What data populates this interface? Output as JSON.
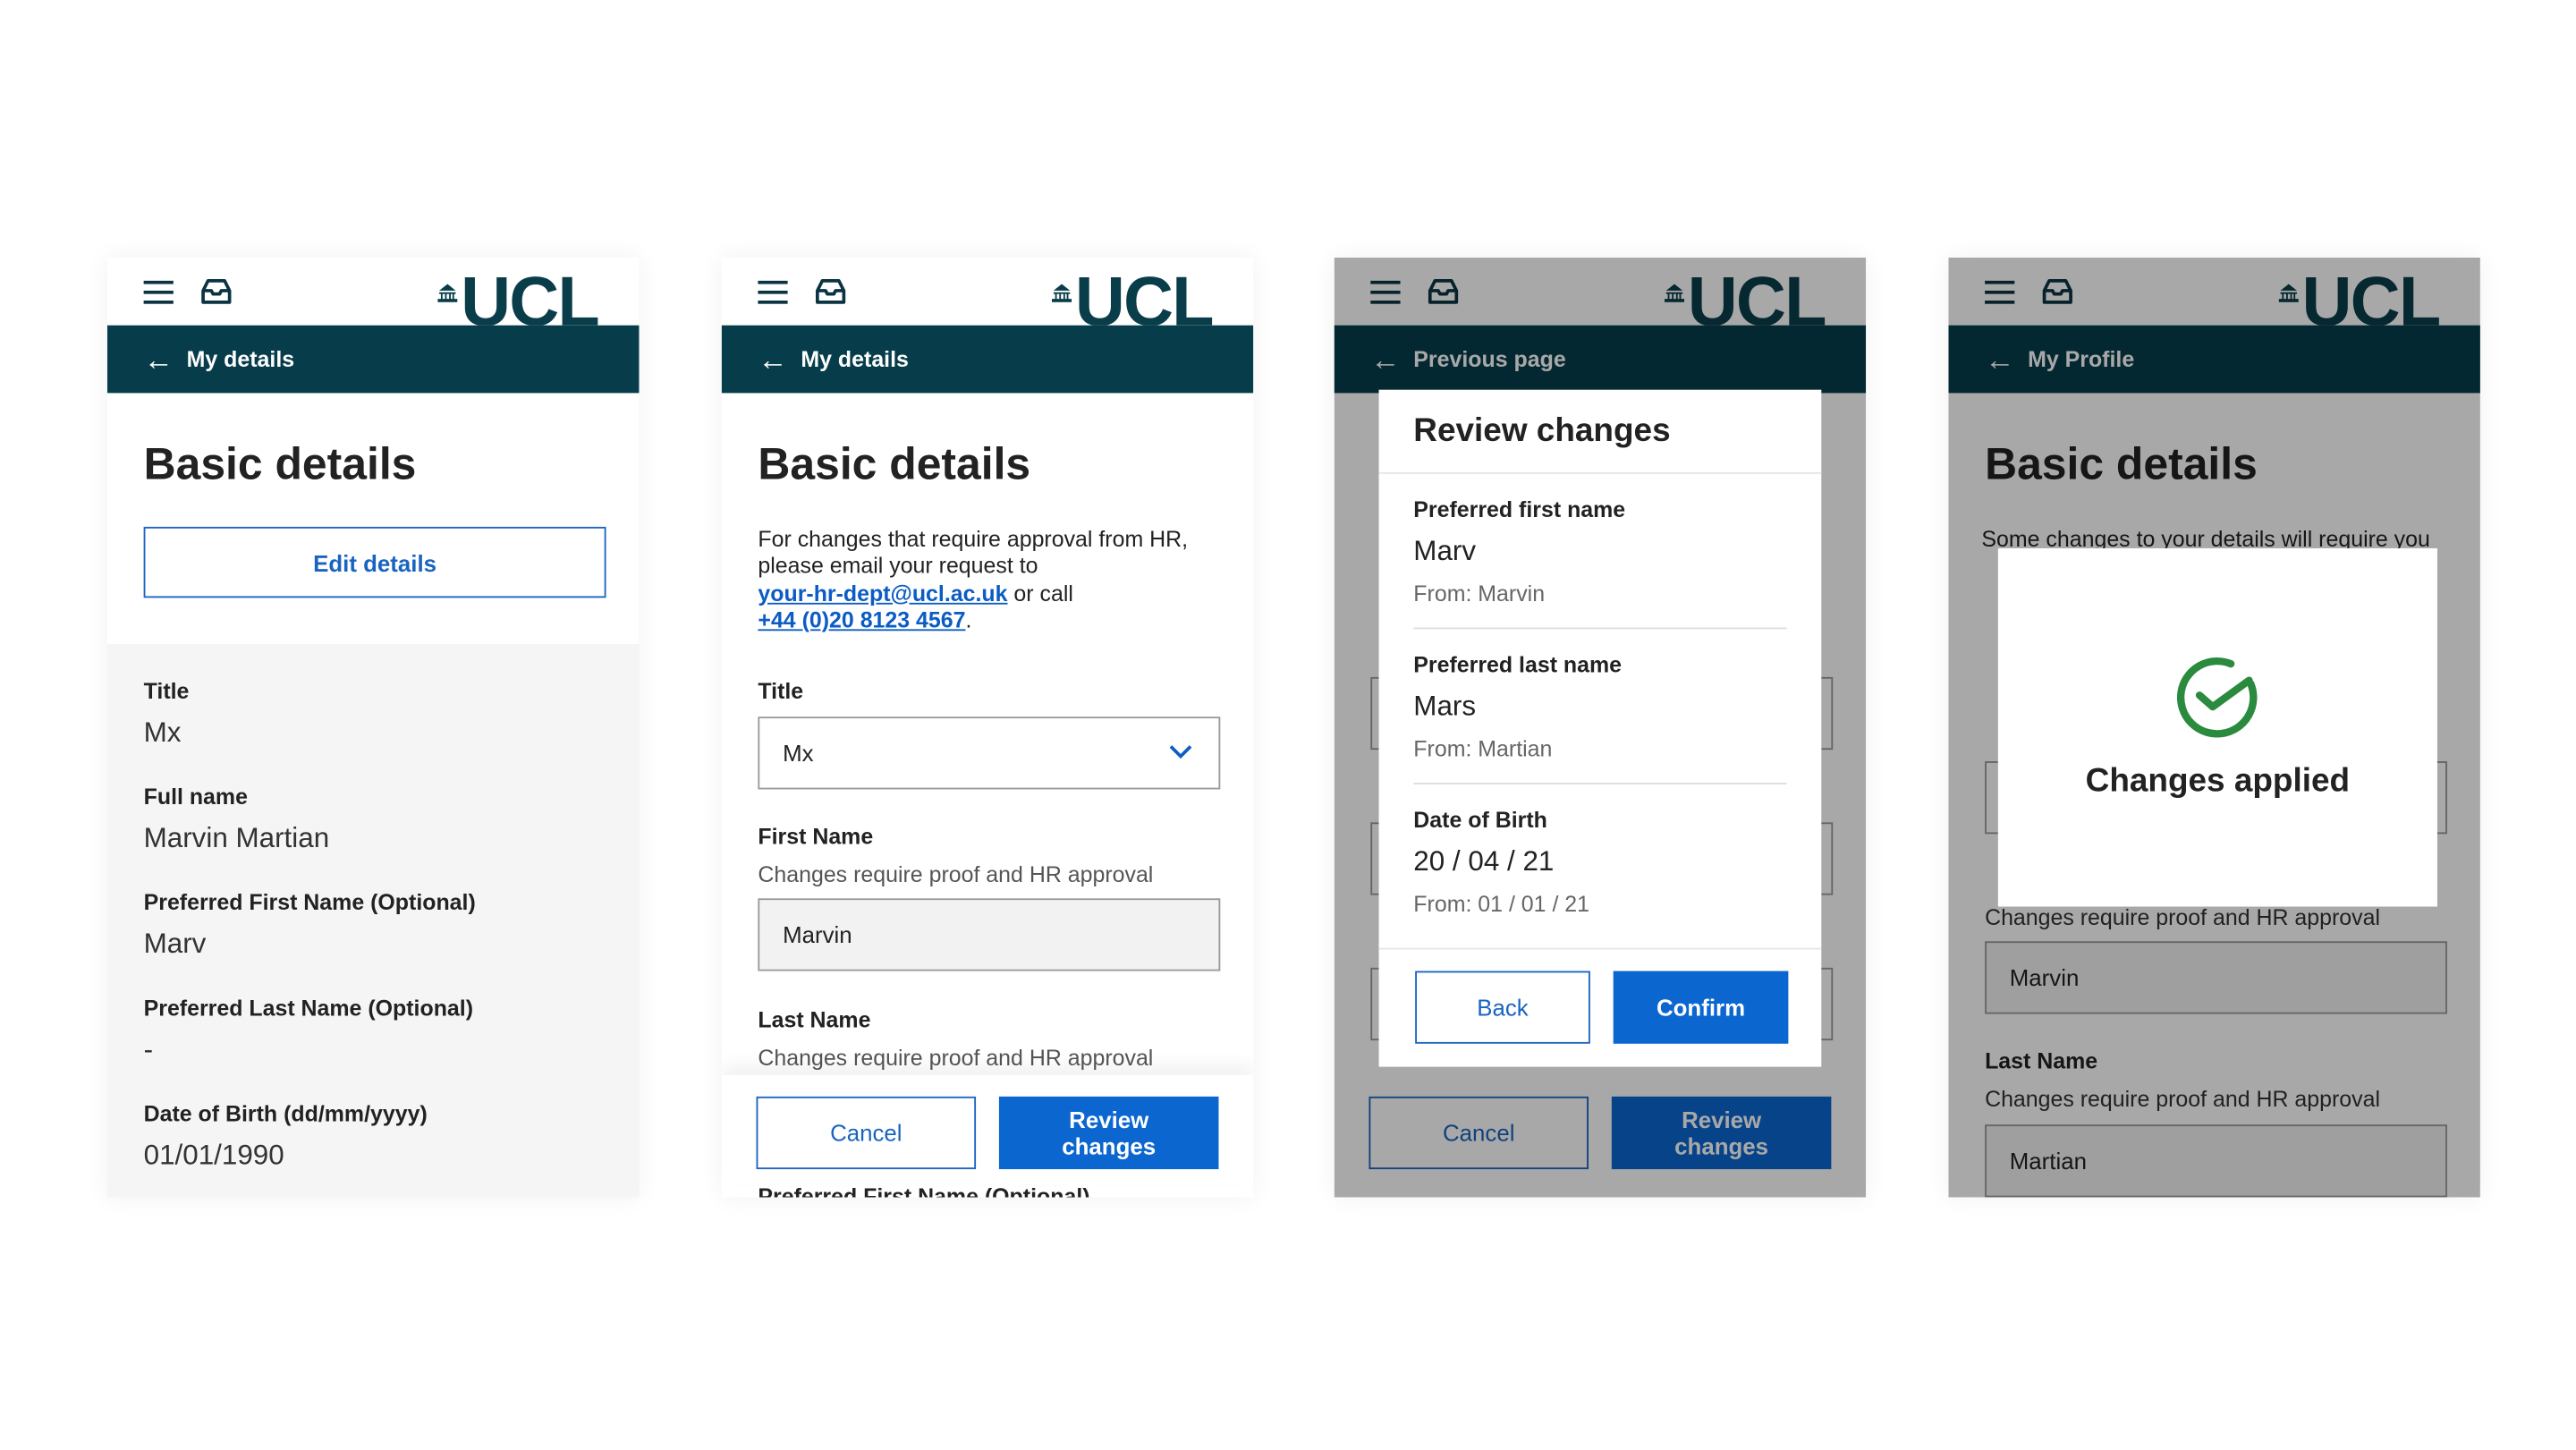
{
  "brand": {
    "logo_text": "UCL",
    "nav_color": "#073d4b",
    "accent": "#0b66d0",
    "success": "#2a8a3e"
  },
  "screens": [
    {
      "nav_label": "My details",
      "title": "Basic details",
      "edit_button": "Edit details",
      "fields": [
        {
          "label": "Title",
          "value": "Mx"
        },
        {
          "label": "Full name",
          "value": "Marvin Martian"
        },
        {
          "label": "Preferred First Name (Optional)",
          "value": "Marv"
        },
        {
          "label": "Preferred Last Name (Optional)",
          "value": "-"
        },
        {
          "label": "Date of Birth (dd/mm/yyyy)",
          "value": "01/01/1990"
        }
      ]
    },
    {
      "nav_label": "My details",
      "title": "Basic details",
      "intro": "For changes that require approval from HR, please email your request to",
      "email": "your-hr-dept@ucl.ac.uk",
      "or_call": " or call",
      "phone": "+44 (0)20 8123 4567",
      "period": ".",
      "title_label": "Title",
      "title_value": "Mx",
      "first_name_label": "First Name",
      "first_name_hint": "Changes require proof and HR approval",
      "first_name_value": "Marvin",
      "last_name_label": "Last Name",
      "last_name_hint": "Changes require proof and HR approval",
      "cancel": "Cancel",
      "review": "Review changes",
      "next_label": "Preferred First Name (Optional)"
    },
    {
      "nav_label": "Previous page",
      "modal": {
        "title": "Review changes",
        "items": [
          {
            "label": "Preferred first name",
            "value": "Marv",
            "from": "From: Marvin"
          },
          {
            "label": "Preferred last name",
            "value": "Mars",
            "from": "From: Martian"
          },
          {
            "label": "Date of Birth",
            "value": "20 / 04 / 21",
            "from": "From: 01 / 01 / 21"
          }
        ],
        "back": "Back",
        "confirm": "Confirm"
      },
      "cancel": "Cancel",
      "review": "Review changes"
    },
    {
      "nav_label": "My Profile",
      "title": "Basic details",
      "intro": "Some changes to your details will require you",
      "first_name_hint": "Changes require proof and HR approval",
      "first_name_value": "Marvin",
      "last_name_label": "Last Name",
      "last_name_hint": "Changes require proof and HR approval",
      "last_name_value": "Martian",
      "toast": "Changes applied"
    }
  ]
}
